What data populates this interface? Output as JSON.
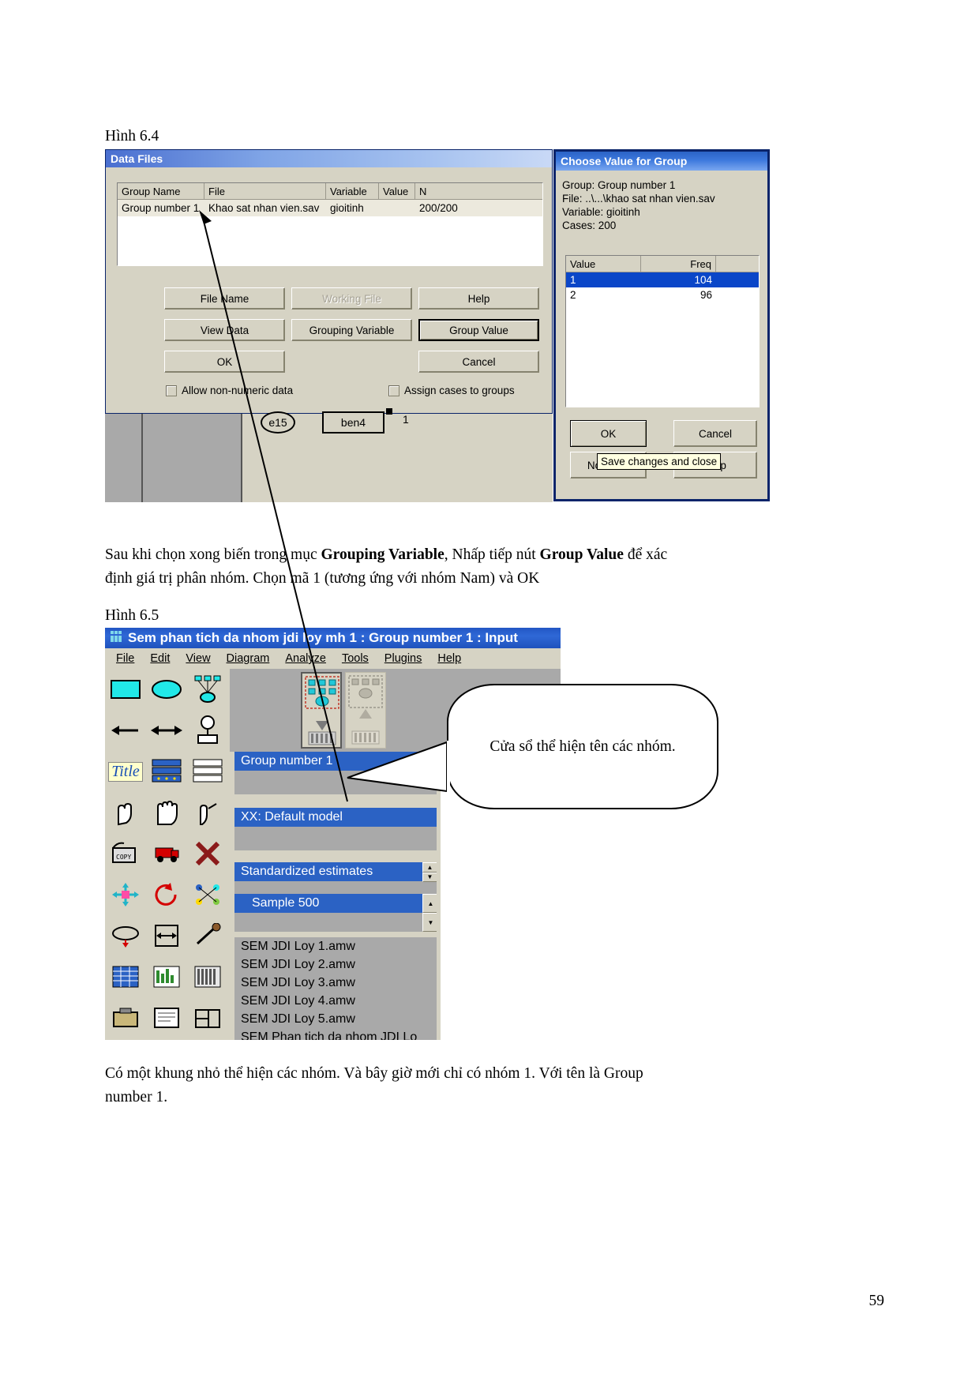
{
  "figure_64": {
    "caption": "Hình 6.4"
  },
  "data_files_dialog": {
    "title": "Data Files",
    "columns": [
      "Group Name",
      "File",
      "Variable",
      "Value",
      "N"
    ],
    "rows": [
      {
        "group_name": "Group number 1",
        "file": "Khao sat nhan vien.sav",
        "variable": "gioitinh",
        "value": "",
        "n": "200/200"
      }
    ],
    "buttons": {
      "file_name": "File Name",
      "working_file": "Working File",
      "help": "Help",
      "view_data": "View Data",
      "grouping_variable": "Grouping Variable",
      "group_value": "Group Value",
      "ok": "OK",
      "cancel": "Cancel"
    },
    "checkboxes": [
      {
        "label": "Allow non-numeric data",
        "checked": false
      },
      {
        "label": "Assign cases to groups",
        "checked": false
      }
    ]
  },
  "choose_value_dialog": {
    "title": "Choose Value for Group",
    "info": {
      "group": "Group: Group number 1",
      "file": "File: ..\\...\\khao sat nhan vien.sav",
      "variable": "Variable: gioitinh",
      "cases": "Cases:  200"
    },
    "columns": [
      "Value",
      "Freq"
    ],
    "rows": [
      {
        "value": "1",
        "freq": "104",
        "selected": true
      },
      {
        "value": "2",
        "freq": "96",
        "selected": false
      }
    ],
    "buttons": {
      "ok": "OK",
      "cancel": "Cancel",
      "no_value": "No value",
      "help": "Help"
    },
    "tooltip": "Save changes and close"
  },
  "paragraph_1": {
    "line1_a": "Sau khi chọn xong biến trong mục ",
    "line1_b": "Grouping Variable",
    "line1_c": ", Nhấp tiếp nút ",
    "line1_d": "Group Value",
    "line1_e": " để xác",
    "line2": "định giá trị phân nhóm. Chọn mã 1 (tương ứng với nhóm Nam) và OK"
  },
  "figure_65": {
    "caption": "Hình 6.5"
  },
  "amos_window": {
    "title": "Sem phan tich da nhom jdi loy mh 1 : Group number 1 : Input",
    "menu": [
      "File",
      "Edit",
      "View",
      "Diagram",
      "Analyze",
      "Tools",
      "Plugins",
      "Help"
    ],
    "panel_rows": [
      "Group number 1",
      "XX: Default model",
      "Standardized estimates",
      "Sample 500"
    ],
    "file_list": [
      "SEM  JDI Loy 1.amw",
      "SEM  JDI Loy 2.amw",
      "SEM  JDI Loy 3.amw",
      "SEM  JDI Loy 4.amw",
      "SEM  JDI Loy 5.amw",
      "SEM Phan tich da nhom JDI Lo"
    ],
    "toolbar_title_label": "Title",
    "diagram_label": "ben4",
    "diagram_error": "e15",
    "diagram_value": "1"
  },
  "callout": {
    "text": "Cửa sổ thể hiện tên các nhóm."
  },
  "paragraph_2": {
    "line1": "Có một khung nhỏ thể hiện các nhóm. Và bây giờ mới chỉ có nhóm 1. Với tên là Group",
    "line2": "number 1."
  },
  "page_number": "59",
  "colors": {
    "dialog_face": "#d6d3c4",
    "selection_blue": "#0a46c8",
    "title_blue": "#2256c4",
    "panel_gray": "#a9a9a9"
  }
}
